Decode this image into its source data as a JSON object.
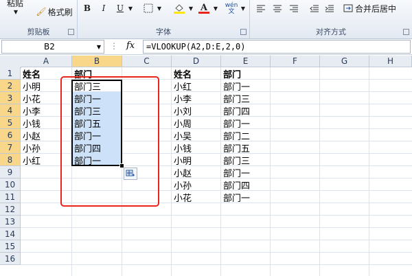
{
  "ribbon": {
    "paste_label": "粘贴",
    "format_painter_label": "格式刷",
    "clipboard_label": "剪贴板",
    "font_label": "字体",
    "bold": "B",
    "italic": "I",
    "underline": "U",
    "wen_label": "wén 文",
    "align_label": "对齐方式",
    "merge_label": "合并后居中"
  },
  "formula_bar": {
    "name_box": "B2",
    "fx": "fx",
    "formula": "=VLOOKUP(A2,D:E,2,0)"
  },
  "columns": [
    "A",
    "B",
    "C",
    "D",
    "E",
    "F",
    "G",
    "H"
  ],
  "rows": [
    "1",
    "2",
    "3",
    "4",
    "5",
    "6",
    "7",
    "8",
    "9",
    "10",
    "11",
    "12",
    "13",
    "14",
    "15",
    "16"
  ],
  "table1": {
    "header": [
      "姓名",
      "部门"
    ],
    "names": [
      "小明",
      "小花",
      "小李",
      "小钱",
      "小赵",
      "小孙",
      "小红"
    ],
    "depts": [
      "部门三",
      "部门一",
      "部门三",
      "部门五",
      "部门一",
      "部门四",
      "部门一"
    ]
  },
  "table2": {
    "header": [
      "姓名",
      "部门"
    ],
    "names": [
      "小红",
      "小李",
      "小刘",
      "小周",
      "小吴",
      "小钱",
      "小明",
      "小赵",
      "小孙",
      "小花"
    ],
    "depts": [
      "部门一",
      "部门三",
      "部门四",
      "部门一",
      "部门二",
      "部门五",
      "部门三",
      "部门一",
      "部门四",
      "部门一"
    ]
  },
  "colors": {
    "selection": "#cde2f8",
    "annotation": "#e8241c",
    "active_header": "#f8d68a"
  }
}
